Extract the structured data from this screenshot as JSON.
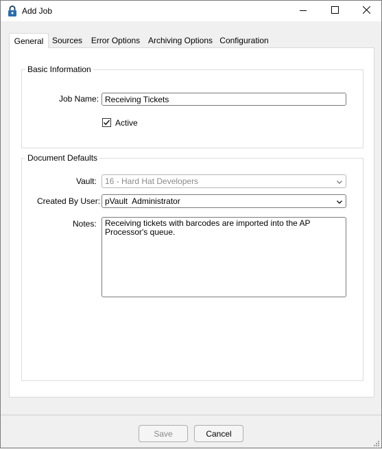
{
  "window": {
    "title": "Add Job",
    "icon": "padlock-icon"
  },
  "tabs": [
    {
      "label": "General",
      "active": true
    },
    {
      "label": "Sources",
      "active": false
    },
    {
      "label": "Error Options",
      "active": false
    },
    {
      "label": "Archiving Options",
      "active": false
    },
    {
      "label": "Configuration",
      "active": false
    }
  ],
  "basic_info": {
    "legend": "Basic Information",
    "job_name_label": "Job Name:",
    "job_name_value": "Receiving Tickets",
    "active_label": "Active",
    "active_checked": true
  },
  "document_defaults": {
    "legend": "Document Defaults",
    "vault_label": "Vault:",
    "vault_value": "16 - Hard Hat Developers",
    "vault_enabled": false,
    "created_by_label": "Created By User:",
    "created_by_value": "pVault  Administrator",
    "notes_label": "Notes:",
    "notes_value": "Receiving tickets with barcodes are imported into the AP Processor's queue."
  },
  "footer": {
    "save_label": "Save",
    "cancel_label": "Cancel"
  }
}
